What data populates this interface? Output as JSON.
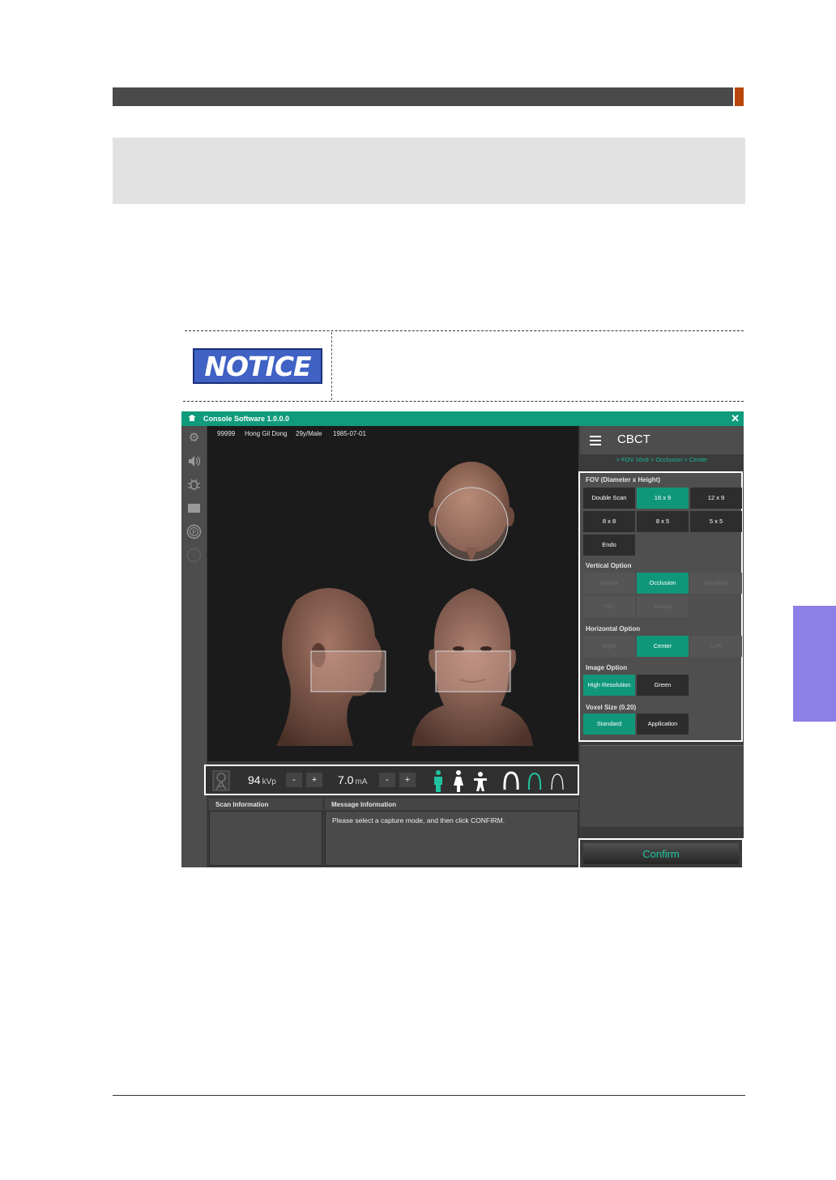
{
  "notice_label": "NOTICE",
  "app": {
    "title": "Console Software  1.0.0.0",
    "close_glyph": "✕",
    "patient": {
      "id": "99999",
      "name": "Hong Gil Dong",
      "age_sex": "29y/Male",
      "birthdate": "1985-07-01"
    },
    "sidebar_icons": [
      "gear-icon",
      "speaker-icon",
      "bug-icon",
      "folder-icon",
      "p-badge-icon",
      "help-icon"
    ],
    "controls": {
      "kvp_value": "94",
      "kvp_unit": "kVp",
      "ma_value": "7.0",
      "ma_unit": "mA",
      "minus": "-",
      "plus": "+",
      "colors": {
        "selected": "#1fc3a0",
        "unselected": "#ffffff"
      }
    },
    "scan_info_label": "Scan Information",
    "message_label": "Message Information",
    "message_text": "Please select a capture mode, and then click CONFIRM.",
    "right_panel": {
      "title": "CBCT",
      "breadcrumb": "> FOV 16x9 > Occlusion > Center",
      "fov_label": "FOV (Diameter x Height)",
      "fov_options": [
        "Double Scan",
        "16 x 9",
        "12 x 9",
        "8 x 8",
        "8 x 5",
        "5 x 5",
        "Endo"
      ],
      "vertical_label": "Vertical Option",
      "vertical_options": [
        "Maxilla",
        "Occlusion",
        "Mandible",
        "TMJ",
        "Airway"
      ],
      "horizontal_label": "Horizontal Option",
      "horizontal_options": [
        "Right",
        "Center",
        "Left"
      ],
      "image_label": "Image Option",
      "image_options": [
        "High Resolution",
        "Green"
      ],
      "voxel_label": "Voxel Size (0.20)",
      "voxel_options": [
        "Standard",
        "Application"
      ],
      "confirm_label": "Confirm"
    },
    "accent_color": "#10977a"
  }
}
